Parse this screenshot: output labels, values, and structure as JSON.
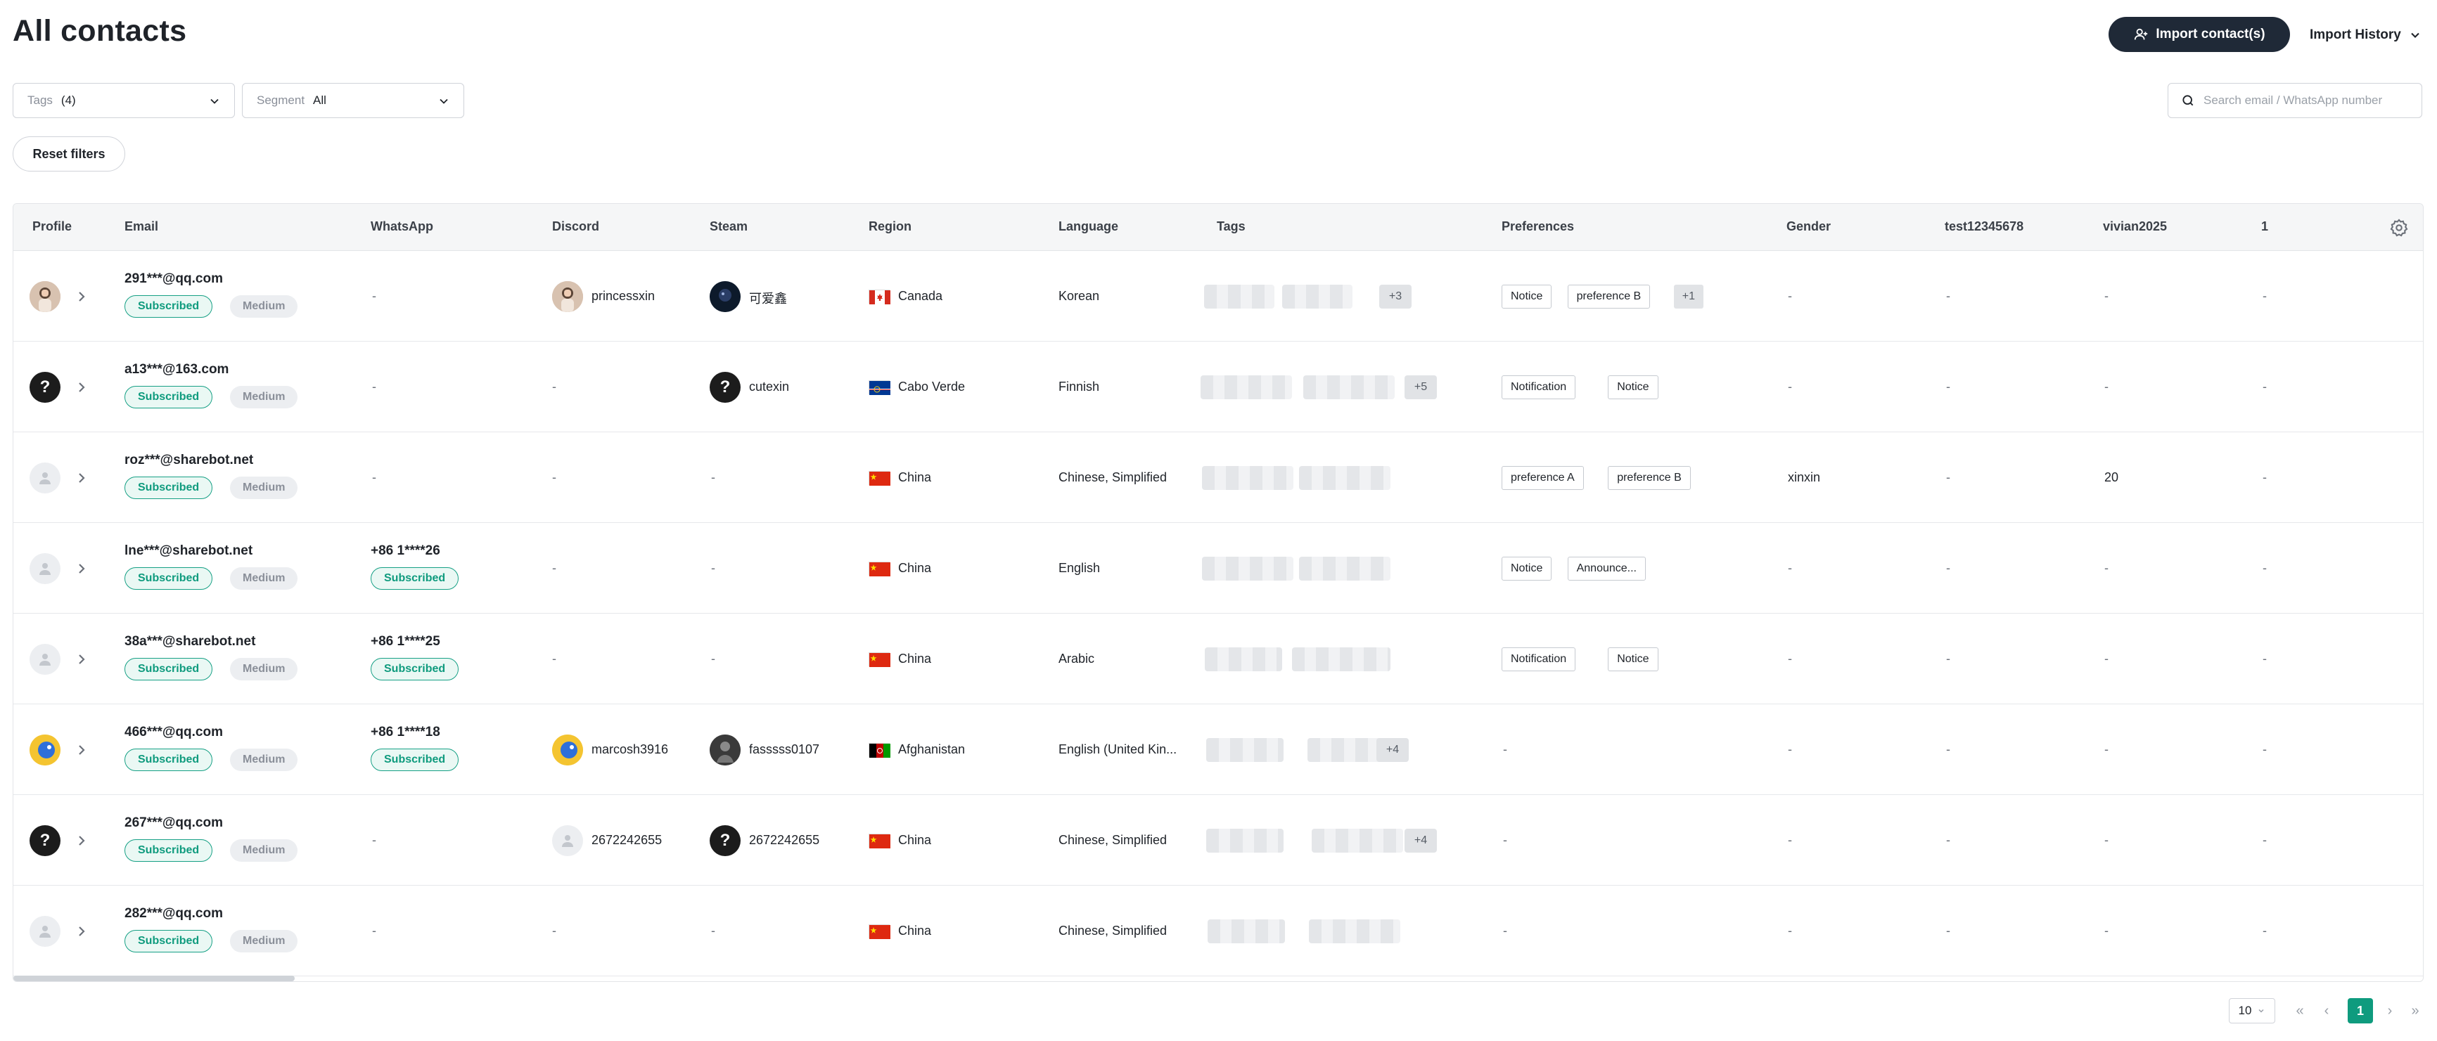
{
  "page": {
    "title": "All contacts"
  },
  "header": {
    "import_button": "Import contact(s)",
    "import_history": "Import History"
  },
  "filters": {
    "tags": {
      "label": "Tags",
      "value": "(4)"
    },
    "segment": {
      "label": "Segment",
      "value": "All"
    },
    "search_placeholder": "Search email / WhatsApp number",
    "reset": "Reset filters"
  },
  "table": {
    "columns": [
      "Profile",
      "Email",
      "WhatsApp",
      "Discord",
      "Steam",
      "Region",
      "Language",
      "Tags",
      "Preferences",
      "Gender",
      "test12345678",
      "vivian2025",
      "1"
    ],
    "rows": [
      {
        "email": "291***@qq.com",
        "email_status": "Subscribed",
        "email_quality": "Medium",
        "whatsapp": "-",
        "whatsapp_status": "",
        "discord": "princessxin",
        "steam": "可爱鑫",
        "region": "Canada",
        "flag": "ca",
        "language": "Korean",
        "tags_more": "+3",
        "preferences": [
          "Notice",
          "preference B"
        ],
        "preferences_more": "+1",
        "gender": "-",
        "test": "-",
        "vivian": "-",
        "col1": "-",
        "avatar": "photo"
      },
      {
        "email": "a13***@163.com",
        "email_status": "Subscribed",
        "email_quality": "Medium",
        "whatsapp": "-",
        "whatsapp_status": "",
        "discord": "-",
        "steam": "cutexin",
        "region": "Cabo Verde",
        "flag": "cv",
        "language": "Finnish",
        "tags_more": "+5",
        "preferences": [
          "Notification",
          "Notice"
        ],
        "preferences_more": "",
        "gender": "-",
        "test": "-",
        "vivian": "-",
        "col1": "-",
        "avatar": "q"
      },
      {
        "email": "roz***@sharebot.net",
        "email_status": "Subscribed",
        "email_quality": "Medium",
        "whatsapp": "-",
        "whatsapp_status": "",
        "discord": "-",
        "steam": "-",
        "region": "China",
        "flag": "cn",
        "language": "Chinese, Simplified",
        "tags_more": "",
        "preferences": [
          "preference A",
          "preference B"
        ],
        "preferences_more": "",
        "gender": "xinxin",
        "test": "-",
        "vivian": "20",
        "col1": "-",
        "avatar": "ph"
      },
      {
        "email": "lne***@sharebot.net",
        "email_status": "Subscribed",
        "email_quality": "Medium",
        "whatsapp": "+86 1****26",
        "whatsapp_status": "Subscribed",
        "discord": "-",
        "steam": "-",
        "region": "China",
        "flag": "cn",
        "language": "English",
        "tags_more": "",
        "preferences": [
          "Notice",
          "Announce..."
        ],
        "preferences_more": "",
        "gender": "-",
        "test": "-",
        "vivian": "-",
        "col1": "-",
        "avatar": "ph"
      },
      {
        "email": "38a***@sharebot.net",
        "email_status": "Subscribed",
        "email_quality": "Medium",
        "whatsapp": "+86 1****25",
        "whatsapp_status": "Subscribed",
        "discord": "-",
        "steam": "-",
        "region": "China",
        "flag": "cn",
        "language": "Arabic",
        "tags_more": "",
        "preferences": [
          "Notification",
          "Notice"
        ],
        "preferences_more": "",
        "gender": "-",
        "test": "-",
        "vivian": "-",
        "col1": "-",
        "avatar": "ph"
      },
      {
        "email": "466***@qq.com",
        "email_status": "Subscribed",
        "email_quality": "Medium",
        "whatsapp": "+86 1****18",
        "whatsapp_status": "Subscribed",
        "discord": "marcosh3916",
        "steam": "fasssss0107",
        "region": "Afghanistan",
        "flag": "af",
        "language": "English (United Kin...",
        "tags_more": "+4",
        "preferences": [],
        "preferences_more": "",
        "gender": "-",
        "test": "-",
        "vivian": "-",
        "col1": "-",
        "avatar": "blue"
      },
      {
        "email": "267***@qq.com",
        "email_status": "Subscribed",
        "email_quality": "Medium",
        "whatsapp": "-",
        "whatsapp_status": "",
        "discord": "2672242655",
        "steam": "2672242655",
        "region": "China",
        "flag": "cn",
        "language": "Chinese, Simplified",
        "tags_more": "+4",
        "preferences": [],
        "preferences_more": "",
        "gender": "-",
        "test": "-",
        "vivian": "-",
        "col1": "-",
        "avatar": "q"
      },
      {
        "email": "282***@qq.com",
        "email_status": "Subscribed",
        "email_quality": "Medium",
        "whatsapp": "-",
        "whatsapp_status": "",
        "discord": "-",
        "steam": "-",
        "region": "China",
        "flag": "cn",
        "language": "Chinese, Simplified",
        "tags_more": "",
        "preferences": [],
        "preferences_more": "",
        "gender": "-",
        "test": "-",
        "vivian": "-",
        "col1": "-",
        "avatar": "ph"
      }
    ],
    "empty_preference": "-"
  },
  "pagination": {
    "page_size": "10",
    "current_page": "1"
  },
  "colors": {
    "accent": "#0f9b7e",
    "dark_button": "#1f2937",
    "header_bg": "#f5f6f7"
  }
}
